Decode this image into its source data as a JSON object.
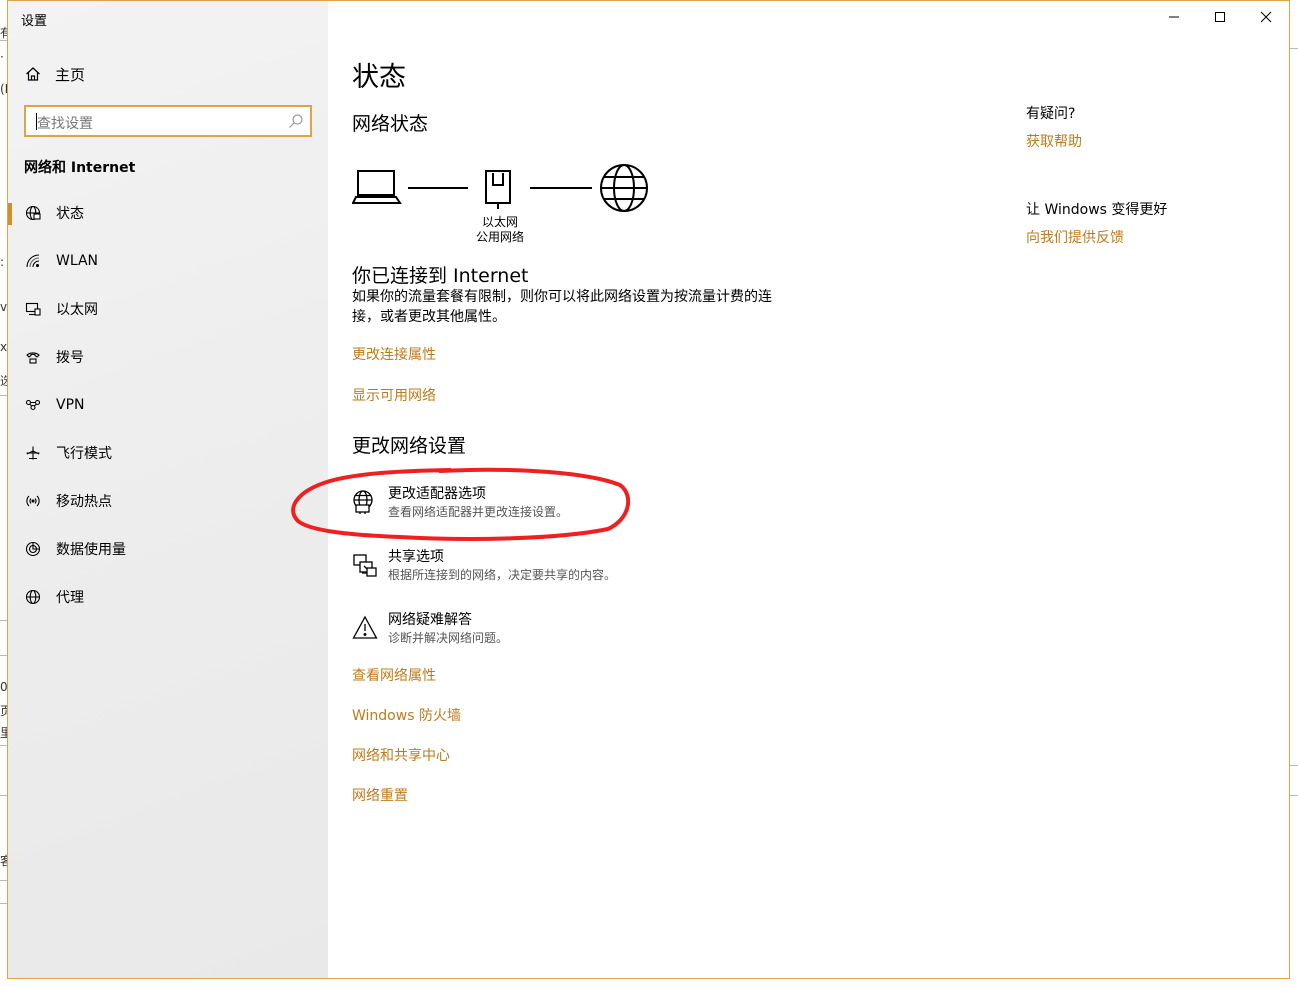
{
  "window": {
    "title": "设置"
  },
  "sidebar": {
    "home_label": "主页",
    "search_placeholder": "查找设置",
    "section_title": "网络和 Internet",
    "items": [
      {
        "label": "状态",
        "icon": "status-icon",
        "selected": true
      },
      {
        "label": "WLAN",
        "icon": "wifi-icon",
        "selected": false
      },
      {
        "label": "以太网",
        "icon": "ethernet-icon",
        "selected": false
      },
      {
        "label": "拨号",
        "icon": "dialup-icon",
        "selected": false
      },
      {
        "label": "VPN",
        "icon": "vpn-icon",
        "selected": false
      },
      {
        "label": "飞行模式",
        "icon": "airplane-icon",
        "selected": false
      },
      {
        "label": "移动热点",
        "icon": "hotspot-icon",
        "selected": false
      },
      {
        "label": "数据使用量",
        "icon": "data-usage-icon",
        "selected": false
      },
      {
        "label": "代理",
        "icon": "globe-icon",
        "selected": false
      }
    ]
  },
  "main": {
    "title": "状态",
    "network_status_heading": "网络状态",
    "diagram": {
      "adapter_name": "以太网",
      "network_type": "公用网络"
    },
    "connected_heading": "你已连接到 Internet",
    "connected_desc": "如果你的流量套餐有限制，则你可以将此网络设置为按流量计费的连接，或者更改其他属性。",
    "link_change_props": "更改连接属性",
    "link_show_networks": "显示可用网络",
    "change_settings_heading": "更改网络设置",
    "options": [
      {
        "title": "更改适配器选项",
        "desc": "查看网络适配器并更改连接设置。",
        "icon": "adapter-icon"
      },
      {
        "title": "共享选项",
        "desc": "根据所连接到的网络，决定要共享的内容。",
        "icon": "sharing-icon"
      },
      {
        "title": "网络疑难解答",
        "desc": "诊断并解决网络问题。",
        "icon": "warning-icon"
      }
    ],
    "bottom_links": [
      "查看网络属性",
      "Windows 防火墙",
      "网络和共享中心",
      "网络重置"
    ]
  },
  "aside": {
    "question": "有疑问?",
    "help_link": "获取帮助",
    "improve": "让 Windows 变得更好",
    "feedback_link": "向我们提供反馈"
  },
  "colors": {
    "accent": "#c07a1c",
    "window_border": "#e0a24c",
    "annotation": "#f02020"
  }
}
